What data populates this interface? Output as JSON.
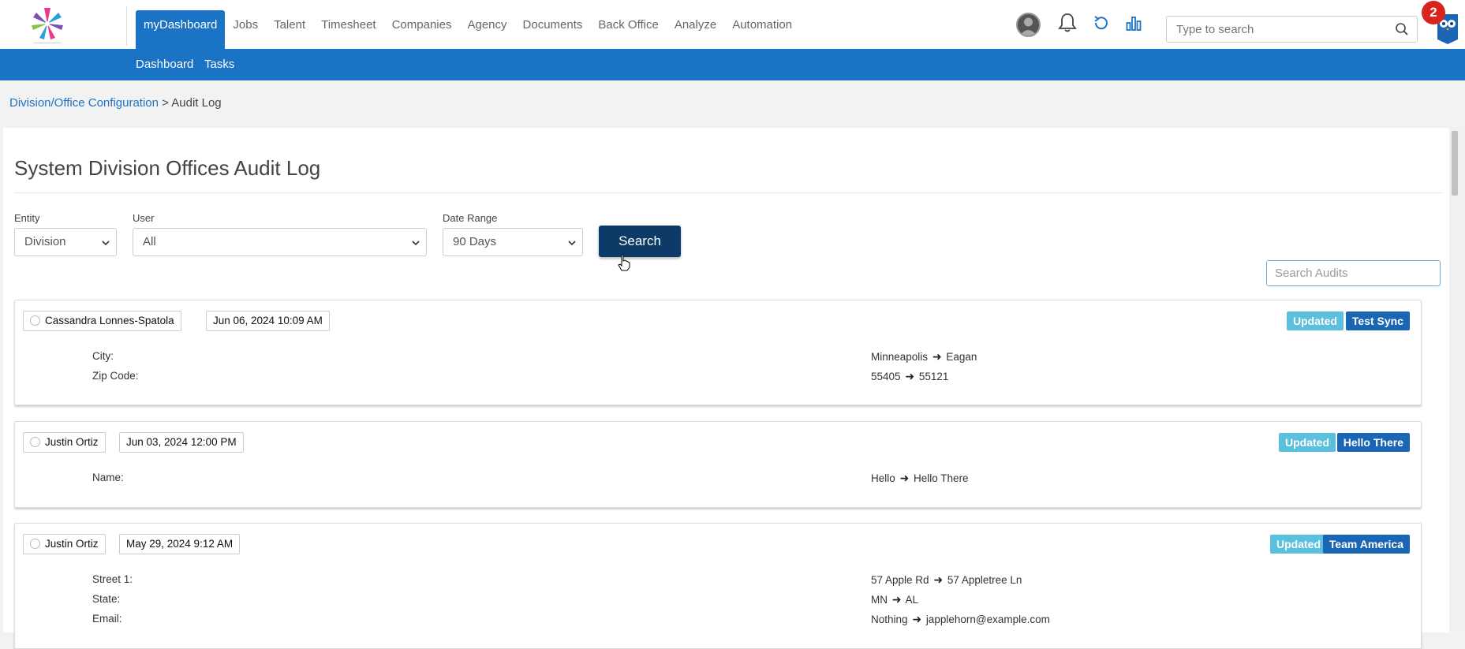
{
  "nav": {
    "items": [
      "myDashboard",
      "Jobs",
      "Talent",
      "Timesheet",
      "Companies",
      "Agency",
      "Documents",
      "Back Office",
      "Analyze",
      "Automation"
    ],
    "active": "myDashboard",
    "search_placeholder": "Type to search",
    "notification_count": "2"
  },
  "subnav": {
    "items": [
      "Dashboard",
      "Tasks"
    ]
  },
  "breadcrumb": {
    "parent": "Division/Office Configuration",
    "separator": ">",
    "current": "Audit Log"
  },
  "page": {
    "title": "System Division Offices Audit Log",
    "filters": {
      "entity_label": "Entity",
      "entity_value": "Division",
      "user_label": "User",
      "user_value": "All",
      "date_label": "Date Range",
      "date_value": "90 Days",
      "search_button": "Search"
    },
    "audit_search_placeholder": "Search Audits"
  },
  "colors": {
    "primary": "#1a73c4",
    "button": "#0d3a66",
    "updated": "#5bc0de",
    "name_tag": "#1a66b5"
  },
  "audits": [
    {
      "user": "Cassandra Lonnes-Spatola",
      "date": "Jun 06, 2024 10:09 AM",
      "action": "Updated",
      "name": "Test Sync",
      "changes": [
        {
          "field": "City:",
          "from": "Minneapolis",
          "to": "Eagan"
        },
        {
          "field": "Zip Code:",
          "from": "55405",
          "to": "55121"
        }
      ]
    },
    {
      "user": "Justin Ortiz",
      "date": "Jun 03, 2024 12:00 PM",
      "action": "Updated",
      "name": "Hello There",
      "changes": [
        {
          "field": "Name:",
          "from": "Hello",
          "to": "Hello There"
        }
      ]
    },
    {
      "user": "Justin Ortiz",
      "date": "May 29, 2024 9:12 AM",
      "action": "Updated",
      "name": "Team America",
      "changes": [
        {
          "field": "Street 1:",
          "from": "57 Apple Rd",
          "to": "57 Appletree Ln"
        },
        {
          "field": "State:",
          "from": "MN",
          "to": "AL"
        },
        {
          "field": "Email:",
          "from": "Nothing",
          "to": "japplehorn@example.com"
        }
      ]
    }
  ]
}
